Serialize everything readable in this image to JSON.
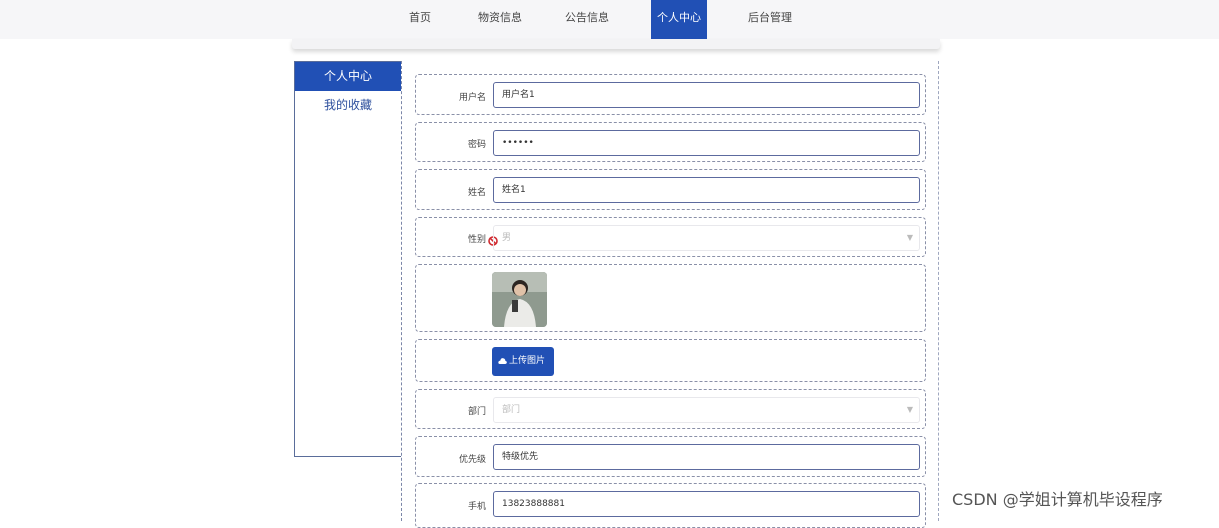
{
  "nav": {
    "items": [
      "首页",
      "物资信息",
      "公告信息",
      "个人中心",
      "后台管理"
    ],
    "active": "个人中心"
  },
  "sidebar": {
    "items": [
      {
        "label": "个人中心",
        "active": true
      },
      {
        "label": "我的收藏",
        "active": false
      }
    ]
  },
  "form": {
    "username": {
      "label": "用户名",
      "value": "用户名1"
    },
    "password": {
      "label": "密码",
      "value": "••••••"
    },
    "name": {
      "label": "姓名",
      "value": "姓名1"
    },
    "gender": {
      "label": "性别",
      "value": "男",
      "icon": "no-entry-icon"
    },
    "avatar": {
      "icon": "avatar-photo"
    },
    "upload": {
      "label": "上传图片",
      "icon": "cloud-upload-icon"
    },
    "department": {
      "label": "部门",
      "placeholder": "部门"
    },
    "priority": {
      "label": "优先级",
      "value": "特级优先"
    },
    "phone": {
      "label": "手机",
      "value": "13823888881"
    }
  },
  "watermark": "CSDN @学姐计算机毕设程序",
  "colors": {
    "accent": "#2150b5",
    "border": "#5c6a9e",
    "nav_bg": "#f6f6f8"
  }
}
